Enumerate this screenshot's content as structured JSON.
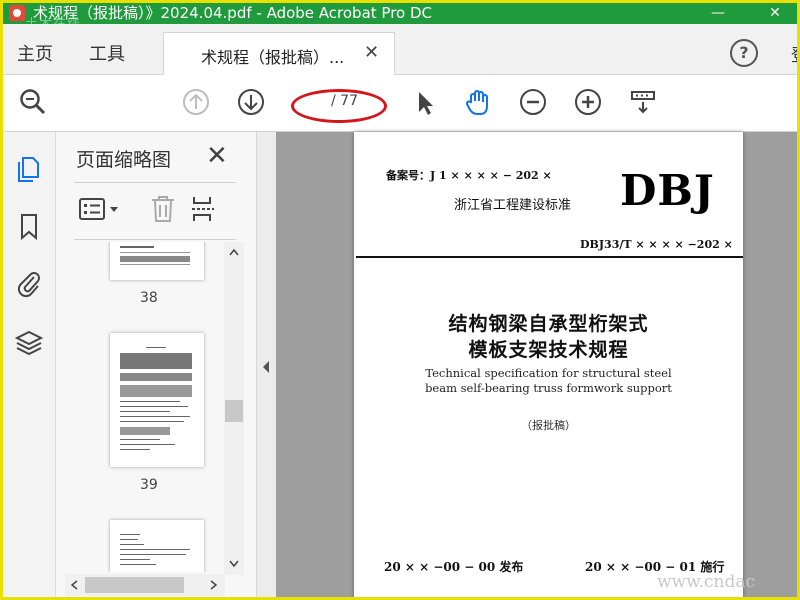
{
  "window": {
    "title": "术规程（报批稿）》2024.04.pdf - Adobe Acrobat Pro DC",
    "watermark": "土木在线",
    "minimize": "—",
    "close": "✕"
  },
  "tabbar": {
    "home": "主页",
    "tools": "工具",
    "doc_tab": "术规程（报批稿）...",
    "doc_tab_close": "✕",
    "help": "?",
    "cut_text": "登"
  },
  "toolbar": {
    "current_page": "",
    "total_pages": "/ 77"
  },
  "thumbnails_panel": {
    "title": "页面缩略图",
    "close": "✕",
    "pages": [
      {
        "label": "38"
      },
      {
        "label": "39"
      },
      {
        "label": ""
      }
    ]
  },
  "document_page": {
    "record_no": "备案号：J 1 × × × × − 202 ×",
    "standard_type": "浙江省工程建设标准",
    "logo": "DBJ",
    "code": "DBJ33/T × × × × −202 ×",
    "title_cn_line1": "结构钢梁自承型桁架式",
    "title_cn_line2": "模板支架技术规程",
    "title_en_line1": "Technical specification for structural steel",
    "title_en_line2": "beam self-bearing truss formwork support",
    "draft_status": "（报批稿）",
    "issue_date": "20 × × −00 − 00 发布",
    "impl_date": "20 × × −00 − 01 施行"
  },
  "watermark_br": "www.cndac",
  "colors": {
    "titlebar": "#1f9a3c",
    "accent_blue": "#1473e6",
    "highlight_red": "#d4161b"
  }
}
